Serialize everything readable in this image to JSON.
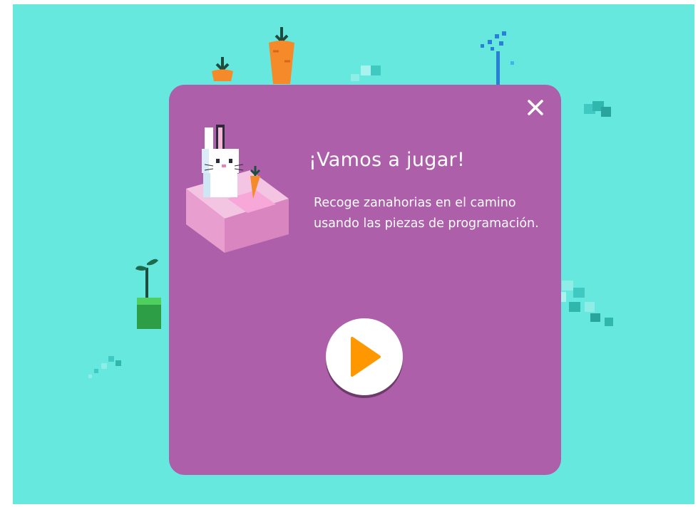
{
  "dialog": {
    "title": "¡Vamos a jugar!",
    "description": "Recoge zanahorias en el camino usando las piezas de programación.",
    "close_icon": "close-icon",
    "play_icon": "play-icon"
  },
  "colors": {
    "background": "#67e8df",
    "dialog": "#ad5fa9",
    "play_triangle": "#ff9800",
    "carrot": "#f58a2a"
  }
}
